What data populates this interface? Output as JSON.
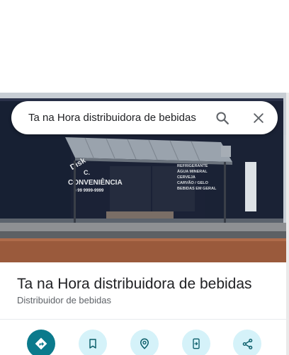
{
  "search": {
    "value": "Ta na Hora distribuidora de bebidas"
  },
  "place": {
    "title": "Ta na Hora distribuidora de bebidas",
    "category": "Distribuidor de bebidas"
  },
  "photo": {
    "sign_left_lines": [
      "Disk",
      "Conveniência",
      "CONVENIÊNCIA"
    ],
    "sign_right_lines": [
      "REFRIGERANTE",
      "ÁGUA MINERAL",
      "CERVEJA",
      "CARVÃO / GELO",
      "BEBIDAS EM GERAL"
    ]
  },
  "actions": [
    {
      "name": "directions",
      "icon": "directions-icon"
    },
    {
      "name": "save",
      "icon": "bookmark-icon"
    },
    {
      "name": "nearby",
      "icon": "nearby-icon"
    },
    {
      "name": "send-to-phone",
      "icon": "send-to-phone-icon"
    },
    {
      "name": "share",
      "icon": "share-icon"
    }
  ],
  "colors": {
    "primary_action": "#0b7a8c",
    "secondary_action_bg": "#d5f2f9",
    "secondary_action_icon": "#0b5e6a"
  }
}
